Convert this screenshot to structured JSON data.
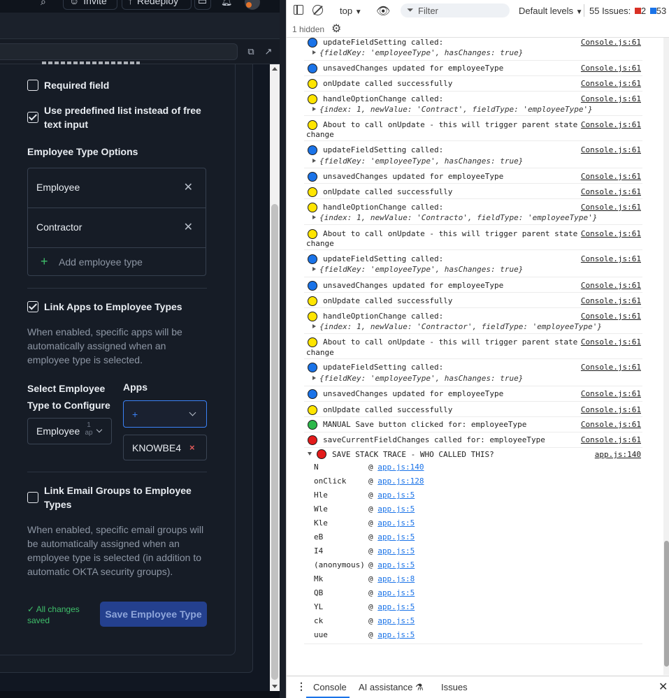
{
  "app": {
    "top_buttons": [
      "Invite",
      "Redeploy"
    ],
    "required_field_label": "Required field",
    "predefined_list_label": "Use predefined list instead of free text input",
    "options_title": "Employee Type Options",
    "options": [
      "Employee",
      "Contractor"
    ],
    "add_option_label": "Add employee type",
    "link_apps_label": "Link Apps to Employee Types",
    "link_apps_desc": "When enabled, specific apps will be automatically assigned when an employee type is selected.",
    "select_type_label_1": "Select Employee",
    "select_type_label_2": "Type to Configure",
    "apps_label": "Apps",
    "selected_type": "Employee",
    "selected_type_badge_1": "1",
    "selected_type_badge_2": "ap",
    "apps_select_value": "+",
    "app_tag": "KNOWBE4",
    "link_email_label": "Link Email Groups to Employee Types",
    "link_email_desc": "When enabled, specific email groups will be automatically assigned when an employee type is selected (in addition to automatic OKTA security groups).",
    "saved_status": "✓ All changes saved",
    "save_button": "Save Employee Type"
  },
  "devtools": {
    "context": "top",
    "filter_placeholder": "Filter",
    "levels": "Default levels",
    "issues_label": "55 Issues:",
    "issues_errors": "2",
    "issues_info": "53",
    "hidden": "1 hidden",
    "drawer_tabs": [
      "Console",
      "AI assistance",
      "Issues"
    ],
    "source": "Console.js:61",
    "trace_source": "app.js:140",
    "trace_title": "SAVE STACK TRACE - WHO CALLED THIS?",
    "manual_save": "MANUAL Save button clicked for: employeeType",
    "save_current": "saveCurrentFieldChanges called for: employeeType",
    "trace": [
      {
        "fn": "N",
        "loc": "app.js:140"
      },
      {
        "fn": "onClick",
        "loc": "app.js:128"
      },
      {
        "fn": "Hle",
        "loc": "app.js:5"
      },
      {
        "fn": "Wle",
        "loc": "app.js:5"
      },
      {
        "fn": "Kle",
        "loc": "app.js:5"
      },
      {
        "fn": "eB",
        "loc": "app.js:5"
      },
      {
        "fn": "I4",
        "loc": "app.js:5"
      },
      {
        "fn": "(anonymous)",
        "loc": "app.js:5"
      },
      {
        "fn": "Mk",
        "loc": "app.js:8"
      },
      {
        "fn": "QB",
        "loc": "app.js:5"
      },
      {
        "fn": "YL",
        "loc": "app.js:5"
      },
      {
        "fn": "ck",
        "loc": "app.js:5"
      },
      {
        "fn": "uue",
        "loc": "app.js:5"
      }
    ],
    "msgs": {
      "update_field": "updateFieldSetting called:",
      "unsaved": "unsavedChanges updated for employeeType",
      "on_update_ok": "onUpdate called successfully",
      "handle_option": "handleOptionChange called:",
      "about_call_1": "About to call onUpdate - this will trigger parent state",
      "about_call_2": "change"
    },
    "obj_field_key": "{fieldKey: 'employeeType', hasChanges: true}",
    "obj_contract": "{index: 1, newValue: 'Contract', fieldType: 'employeeType'}",
    "obj_contracto": "{index: 1, newValue: 'Contracto', fieldType: 'employeeType'}",
    "obj_contractor": "{index: 1, newValue: 'Contractor', fieldType: 'employeeType'}"
  }
}
